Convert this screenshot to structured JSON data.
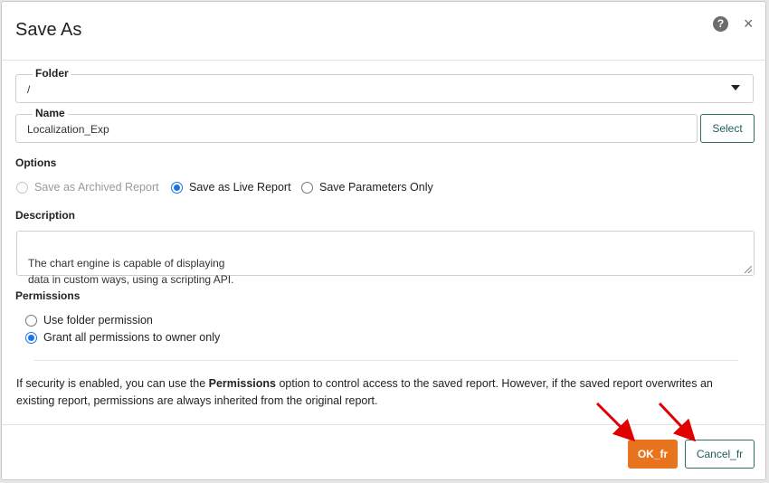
{
  "dialog": {
    "title": "Save As",
    "help_icon": "?",
    "close_icon": "×"
  },
  "folder": {
    "legend": "Folder",
    "value": "/"
  },
  "name": {
    "legend": "Name",
    "value": "Localization_Exp",
    "select_label": "Select"
  },
  "options": {
    "label": "Options",
    "items": [
      {
        "label": "Save as Archived Report",
        "checked": false,
        "disabled": true
      },
      {
        "label": "Save as Live Report",
        "checked": true,
        "disabled": false
      },
      {
        "label": "Save Parameters Only",
        "checked": false,
        "disabled": false
      }
    ]
  },
  "description": {
    "label": "Description",
    "value": "The chart engine is capable of displaying\ndata in custom ways, using a scripting API."
  },
  "permissions": {
    "label": "Permissions",
    "items": [
      {
        "label": "Use folder permission",
        "checked": false
      },
      {
        "label": "Grant all permissions to owner only",
        "checked": true
      }
    ]
  },
  "info": {
    "before": "If security is enabled, you can use the ",
    "bold": "Permissions",
    "after": " option to control access to the saved report. However, if the saved report overwrites an existing report, permissions are always inherited from the original report."
  },
  "footer": {
    "ok_label": "OK_fr",
    "cancel_label": "Cancel_fr"
  },
  "colors": {
    "accent": "#e8741e",
    "radio": "#1a73e8",
    "teal": "#2f6f6a",
    "annotation_arrow": "#e00000"
  }
}
